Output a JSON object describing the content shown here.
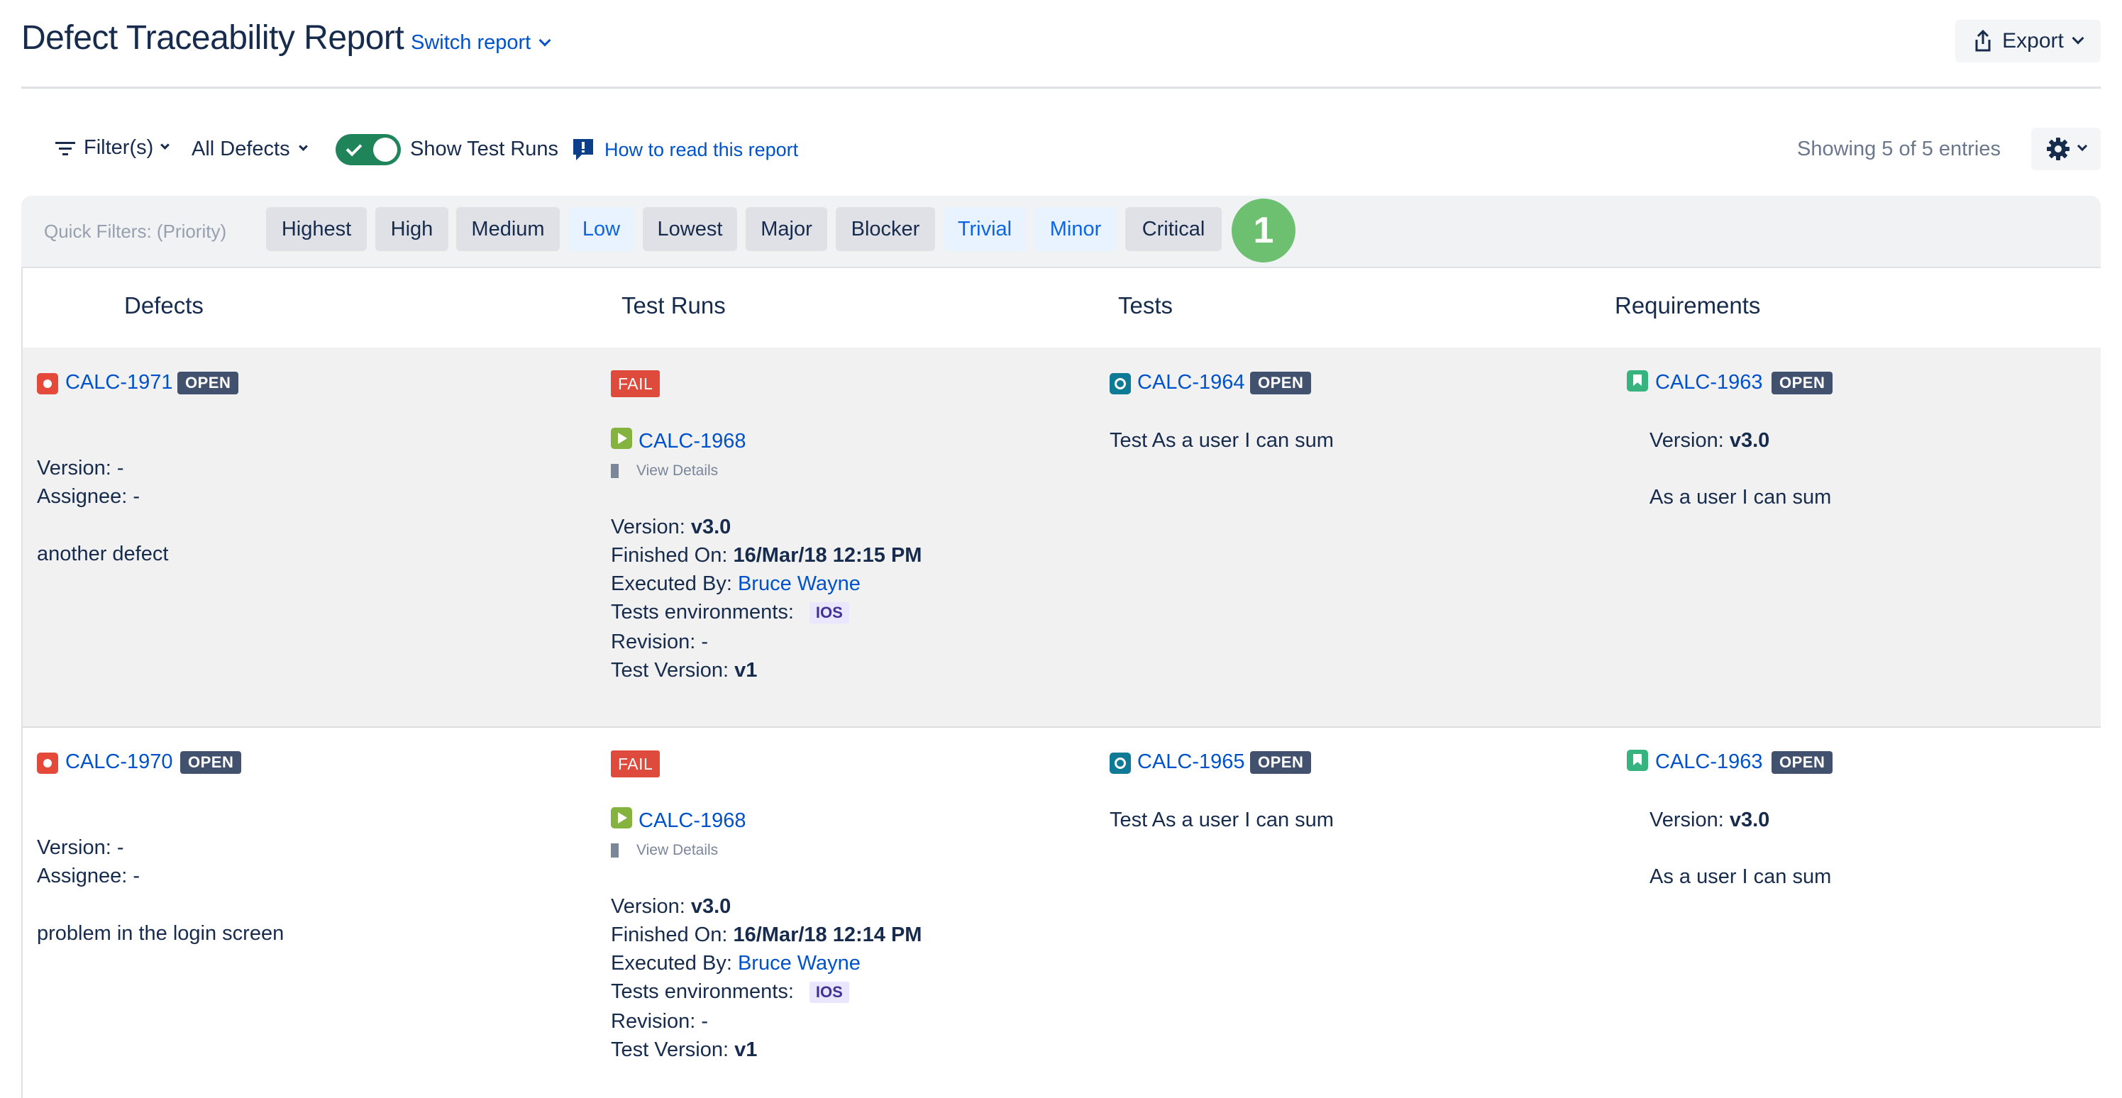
{
  "header": {
    "title": "Defect Traceability Report",
    "switch_report": "Switch report",
    "export_label": "Export"
  },
  "toolbar": {
    "filters_label": "Filter(s)",
    "defects_scope": "All Defects",
    "show_test_runs_label": "Show Test Runs",
    "show_test_runs_enabled": true,
    "how_to_read": "How to read this report",
    "entries_text": "Showing 5 of 5 entries"
  },
  "quick_filters": {
    "label": "Quick Filters: (Priority)",
    "marker": "1",
    "chips": [
      {
        "label": "Highest",
        "style": "grey"
      },
      {
        "label": "High",
        "style": "grey"
      },
      {
        "label": "Medium",
        "style": "grey"
      },
      {
        "label": "Low",
        "style": "blue"
      },
      {
        "label": "Lowest",
        "style": "grey"
      },
      {
        "label": "Major",
        "style": "grey"
      },
      {
        "label": "Blocker",
        "style": "grey"
      },
      {
        "label": "Trivial",
        "style": "blue"
      },
      {
        "label": "Minor",
        "style": "blue"
      },
      {
        "label": "Critical",
        "style": "grey"
      }
    ]
  },
  "table": {
    "columns": [
      "Defects",
      "Test Runs",
      "Tests",
      "Requirements"
    ],
    "rows": [
      {
        "defect": {
          "key": "CALC-1971",
          "status": "OPEN",
          "version_label": "Version:",
          "version": "-",
          "assignee_label": "Assignee:",
          "assignee": "-",
          "summary": "another defect"
        },
        "run": {
          "result": "FAIL",
          "key": "CALC-1968",
          "view_details": "View Details",
          "version_label": "Version:",
          "version": "v3.0",
          "finished_label": "Finished On:",
          "finished": "16/Mar/18 12:15 PM",
          "executed_label": "Executed By:",
          "executed_by": "Bruce Wayne",
          "env_label": "Tests environments:",
          "env": "IOS",
          "revision_label": "Revision:",
          "revision": "-",
          "test_version_label": "Test Version:",
          "test_version": "v1"
        },
        "test": {
          "key": "CALC-1964",
          "status": "OPEN",
          "summary": "Test As a user I can sum"
        },
        "requirement": {
          "key": "CALC-1963",
          "status": "OPEN",
          "version_label": "Version:",
          "version": "v3.0",
          "summary": "As a user I can sum"
        }
      },
      {
        "defect": {
          "key": "CALC-1970",
          "status": "OPEN",
          "version_label": "Version:",
          "version": "-",
          "assignee_label": "Assignee:",
          "assignee": "-",
          "summary": "problem in the login screen"
        },
        "run": {
          "result": "FAIL",
          "key": "CALC-1968",
          "view_details": "View Details",
          "version_label": "Version:",
          "version": "v3.0",
          "finished_label": "Finished On:",
          "finished": "16/Mar/18 12:14 PM",
          "executed_label": "Executed By:",
          "executed_by": "Bruce Wayne",
          "env_label": "Tests environments:",
          "env": "IOS",
          "revision_label": "Revision:",
          "revision": "-",
          "test_version_label": "Test Version:",
          "test_version": "v1"
        },
        "test": {
          "key": "CALC-1965",
          "status": "OPEN",
          "summary": "Test As a user I can sum"
        },
        "requirement": {
          "key": "CALC-1963",
          "status": "OPEN",
          "version_label": "Version:",
          "version": "v3.0",
          "summary": "As a user I can sum"
        }
      }
    ]
  }
}
